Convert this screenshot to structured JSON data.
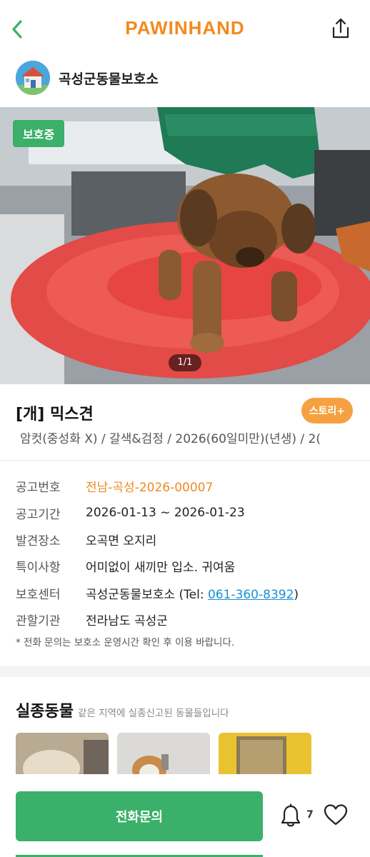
{
  "header": {
    "logo": "PAWINHAND",
    "back_icon": "chevron-left-icon",
    "share_icon": "share-icon"
  },
  "shelter": {
    "name": "곡성군동물보호소",
    "avatar_icon": "house-icon"
  },
  "photo": {
    "status_badge": "보호중",
    "counter": "1/1"
  },
  "animal": {
    "title": "[개] 믹스견",
    "story_button": "스토리+",
    "summary": "암컷(중성화 X) / 갈색&검정 / 2026(60일미만)(년생) / 2("
  },
  "info": [
    {
      "label": "공고번호",
      "value": "전남-곡성-2026-00007"
    },
    {
      "label": "공고기간",
      "value": "2026-01-13 ~ 2026-01-23"
    },
    {
      "label": "발견장소",
      "value": "오곡면 오지리"
    },
    {
      "label": "특이사항",
      "value": "어미없이 새끼만 입소. 귀여움"
    },
    {
      "label": "보호센터",
      "value": "곡성군동물보호소 (Tel: ",
      "tel": "061-360-8392",
      "suffix": ")"
    },
    {
      "label": "관할기관",
      "value": "전라남도 곡성군"
    }
  ],
  "note": "* 전화 문의는 보호소 운영시간 확인 후 이용 바랍니다.",
  "missing": {
    "title": "실종동물",
    "subtitle": "같은 지역에 실종신고된 동물들입니다"
  },
  "bottom": {
    "call_button": "전화문의",
    "bell_count": "7"
  },
  "colors": {
    "brand_orange": "#f28a1e",
    "green": "#3bb06a",
    "link_blue": "#1a8fd6"
  }
}
